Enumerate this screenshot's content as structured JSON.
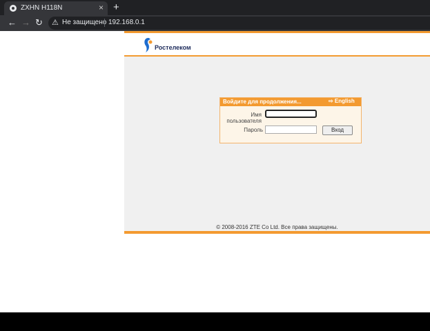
{
  "browser": {
    "tab_title": "ZXHN H118N",
    "new_tab_symbol": "+",
    "close_symbol": "×",
    "security_text": "Не защищено",
    "url": "192.168.0.1"
  },
  "router_page": {
    "brand": "Ростелеком",
    "login_title": "Войдите для продолжения...",
    "language_link": "⇨ English",
    "username_label": "Имя пользователя",
    "username_value": "",
    "password_label": "Пароль",
    "password_value": "",
    "login_button": "Вход",
    "copyright": "© 2008-2016 ZTE Co Ltd. Все права защищены.",
    "accent_color": "#f39a30",
    "brand_color": "#1e2c5c"
  }
}
